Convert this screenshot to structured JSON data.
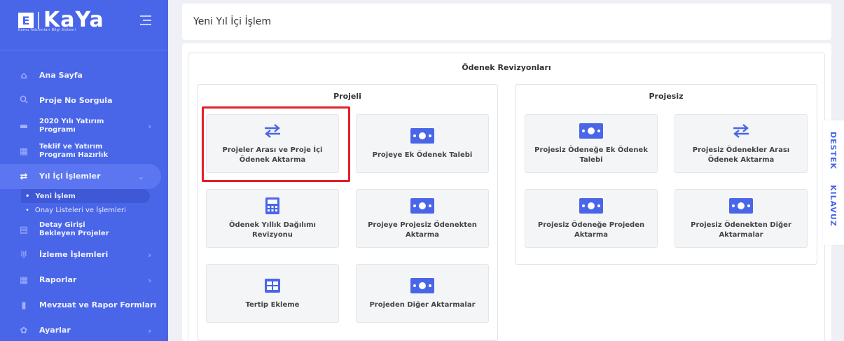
{
  "brand": {
    "name": "KaYa",
    "subtitle": "Kamu Yatırımları Bilgi Sistemi"
  },
  "header": {
    "title": "Yeni Yıl İçi İşlem"
  },
  "sidebar": {
    "items": [
      {
        "label": "Ana Sayfa",
        "icon": "home-icon"
      },
      {
        "label": "Proje No Sorgula",
        "icon": "search-icon"
      },
      {
        "label": "2020 Yılı Yatırım Programı",
        "icon": "folder-icon"
      },
      {
        "label": "Teklif ve Yatırım Programı Hazırlık",
        "icon": "chart-icon"
      },
      {
        "label": "Yıl İçi İşlemler",
        "icon": "exchange-icon"
      },
      {
        "label": "Detay Girişi Bekleyen Projeler",
        "icon": "list-icon"
      },
      {
        "label": "İzleme İşlemleri",
        "icon": "binoculars-icon"
      },
      {
        "label": "Raporlar",
        "icon": "chart-icon"
      },
      {
        "label": "Mevzuat ve Rapor Formları",
        "icon": "file-icon"
      },
      {
        "label": "Ayarlar",
        "icon": "gear-icon"
      }
    ],
    "subitems": [
      {
        "label": "Yeni İşlem"
      },
      {
        "label": "Onay Listeleri ve İşlemleri"
      }
    ]
  },
  "main": {
    "panel_title": "Ödenek Revizyonları",
    "groups": {
      "projeli": {
        "title": "Projeli",
        "tiles": [
          {
            "label": "Projeler Arası ve Proje İçi Ödenek Aktarma",
            "icon": "exchange-icon"
          },
          {
            "label": "Projeye Ek Ödenek Talebi",
            "icon": "money-icon"
          },
          {
            "label": "Ödenek Yıllık Dağılımı Revizyonu",
            "icon": "calculator-icon"
          },
          {
            "label": "Projeye Projesiz Ödenekten Aktarma",
            "icon": "money-icon"
          },
          {
            "label": "Tertip Ekleme",
            "icon": "table-icon"
          },
          {
            "label": "Projeden Diğer Aktarmalar",
            "icon": "money-icon"
          }
        ]
      },
      "projesiz": {
        "title": "Projesiz",
        "tiles": [
          {
            "label": "Projesiz Ödeneğe Ek Ödenek Talebi",
            "icon": "money-icon"
          },
          {
            "label": "Projesiz Ödenekler Arası Ödenek Aktarma",
            "icon": "exchange-icon"
          },
          {
            "label": "Projesiz Ödeneğe Projeden Aktarma",
            "icon": "money-icon"
          },
          {
            "label": "Projesiz Ödenekten Diğer Aktarmalar",
            "icon": "money-icon"
          }
        ]
      }
    }
  },
  "side_tabs": {
    "destek": "DESTEK",
    "kilavuz": "KILAVUZ"
  },
  "colors": {
    "sidebar": "#4a66e8",
    "accent": "#4a66e8",
    "highlight": "#e0202a"
  }
}
